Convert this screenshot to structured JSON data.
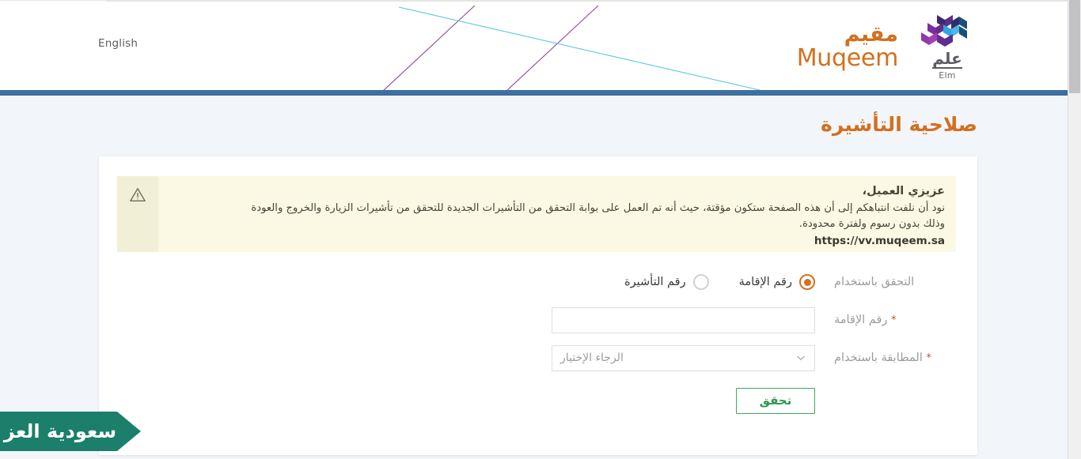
{
  "header": {
    "language_link": "English",
    "brand": {
      "muqeem_ar": "مقيم",
      "muqeem_en": "Muqeem",
      "elm_ar": "علم",
      "elm_en": "Elm"
    },
    "accent_orange": "#d2701f",
    "bar_blue": "#3d6fa0"
  },
  "page": {
    "title": "صلاحية التأشيرة",
    "background": "#f2f5fa"
  },
  "alert": {
    "icon": "warning-triangle-icon",
    "title": "عزيزي العميل،",
    "line1": "نود أن نلفت انتباهكم إلى أن هذه الصفحة ستكون مؤقتة، حيث أنه تم العمل على بوابة التحقق من التأشيرات الجديدة للتحقق من تأشيرات الزيارة والخروج والعودة",
    "line2": "وذلك بدون رسوم ولفترة محدودة.",
    "url": "https://vv.muqeem.sa",
    "background": "#fbf8e3"
  },
  "form": {
    "verify_by": {
      "label": "التحقق باستخدام",
      "options": [
        {
          "label": "رقم الإقامة",
          "selected": true
        },
        {
          "label": "رقم التأشيرة",
          "selected": false
        }
      ]
    },
    "iqama": {
      "label": "رقم الإقامة",
      "required_mark": "*",
      "value": "",
      "placeholder": ""
    },
    "match_by": {
      "label": "المطابقة باستخدام",
      "required_mark": "*",
      "selected": "الرجاء الإختيار",
      "chevron": "chevron-down-icon"
    },
    "submit": {
      "label": "تحقق",
      "color": "#2f9650"
    }
  },
  "watermark": {
    "text": "سعودية العز",
    "color": "#1b7f6b"
  }
}
